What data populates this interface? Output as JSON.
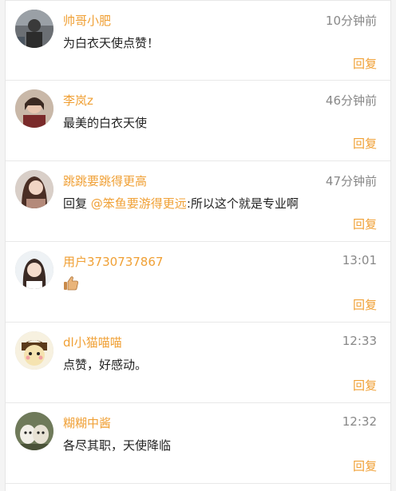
{
  "comments": [
    {
      "username": "帅哥小肥",
      "time": "10分钟前",
      "text": "为白衣天使点赞！",
      "reply_label": "回复"
    },
    {
      "username": "李岚z",
      "time": "46分钟前",
      "text": "最美的白衣天使",
      "reply_label": "回复"
    },
    {
      "username": "跳跳要跳得更高",
      "time": "47分钟前",
      "reply_prefix": "回复",
      "mention": "@笨鱼要游得更远",
      "text": ":所以这个就是专业啊",
      "reply_label": "回复"
    },
    {
      "username": "用户3730737867",
      "time": "13:01",
      "emoji": "thumbs-up-icon",
      "reply_label": "回复"
    },
    {
      "username": "dl小猫喵喵",
      "time": "12:33",
      "text": "点赞，好感动。",
      "reply_label": "回复"
    },
    {
      "username": "糊糊中酱",
      "time": "12:32",
      "text": "各尽其职，天使降临",
      "reply_label": "回复"
    }
  ],
  "colors": {
    "accent": "#f0a035",
    "time": "#888888",
    "text": "#222222"
  }
}
